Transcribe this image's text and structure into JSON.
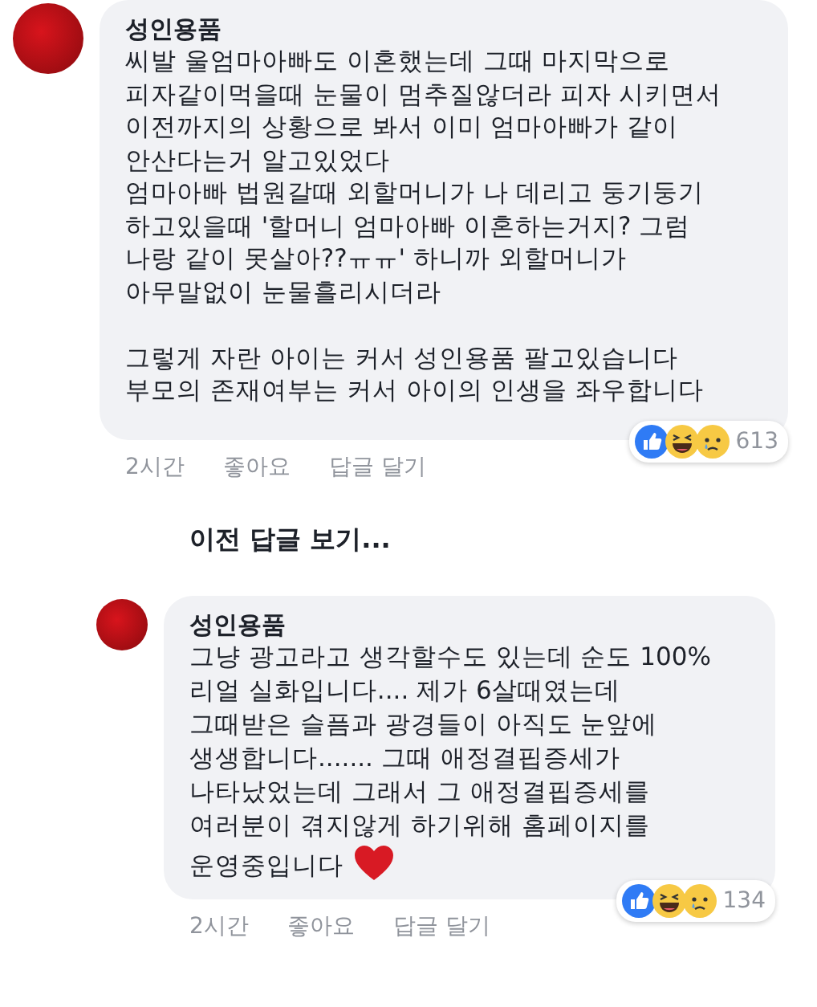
{
  "comments": [
    {
      "author": "성인용품",
      "text": "씨발 울엄마아빠도 이혼했는데 그때 마지막으로\n피자같이먹을때 눈물이 멈추질않더라 피자 시키면서\n이전까지의 상황으로 봐서 이미 엄마아빠가 같이\n안산다는거 알고있었다\n엄마아빠 법원갈때 외할머니가 나 데리고 둥기둥기\n하고있을때 '할머니 엄마아빠 이혼하는거지? 그럼\n나랑 같이 못살아??ㅠㅠ' 하니까 외할머니가\n아무말없이 눈물흘리시더라\n\n그렇게 자란 아이는 커서 성인용품 팔고있습니다\n부모의 존재여부는 커서 아이의 인생을 좌우합니다",
      "heart": false,
      "time": "2시간",
      "like": "좋아요",
      "reply": "답글 달기",
      "reaction_count": "613"
    },
    {
      "author": "성인용품",
      "text": "그냥 광고라고 생각할수도 있는데 순도 100%\n리얼 실화입니다.... 제가 6살때였는데\n그때받은 슬픔과 광경들이 아직도 눈앞에\n생생합니다....... 그때 애정결핍증세가\n나타났었는데 그래서 그 애정결핍증세를\n여러분이 겪지않게 하기위해 홈페이지를\n운영중입니다",
      "heart": true,
      "time": "2시간",
      "like": "좋아요",
      "reply": "답글 달기",
      "reaction_count": "134"
    }
  ],
  "previous_replies": "이전 답글 보기..."
}
